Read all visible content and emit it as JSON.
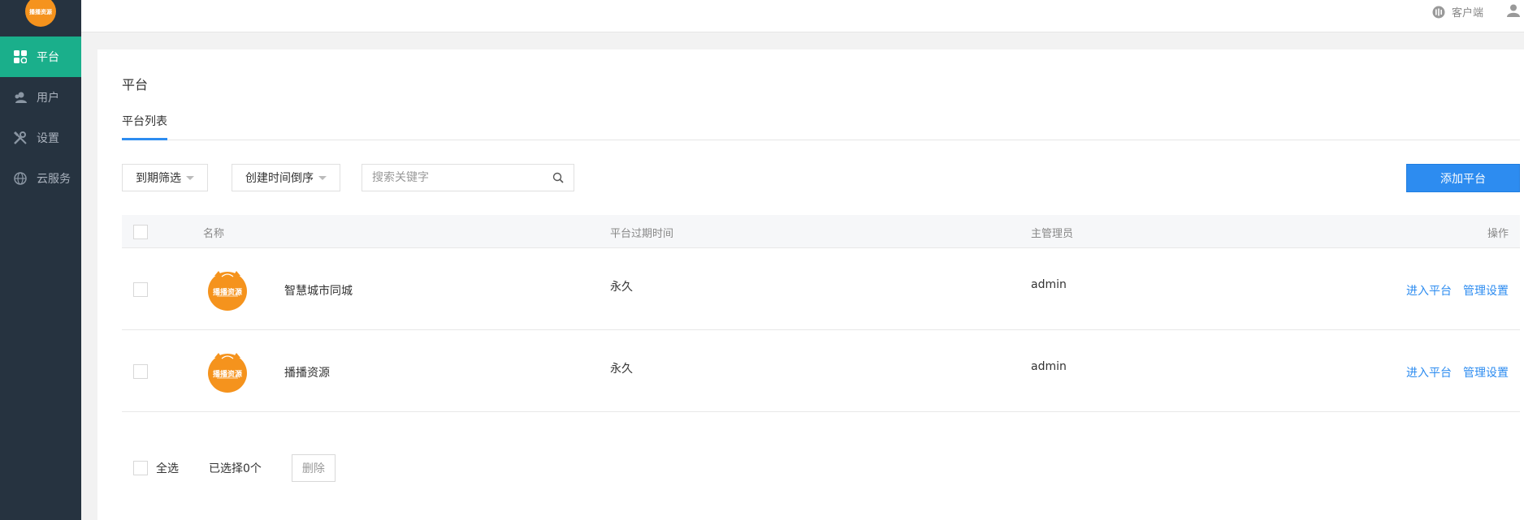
{
  "sidebar": {
    "logo_text": "播播资源",
    "items": [
      {
        "label": "平台",
        "icon": "grid-icon",
        "active": true
      },
      {
        "label": "用户",
        "icon": "users-icon",
        "active": false
      },
      {
        "label": "设置",
        "icon": "wrench-icon",
        "active": false
      },
      {
        "label": "云服务",
        "icon": "globe-icon",
        "active": false
      }
    ]
  },
  "topbar": {
    "client_label": "客户端"
  },
  "page": {
    "title": "平台",
    "tab_active": "平台列表"
  },
  "toolbar": {
    "filter_expire": "到期筛选",
    "sort_created": "创建时间倒序",
    "search_placeholder": "搜索关键字",
    "add_button": "添加平台"
  },
  "table": {
    "headers": {
      "name": "名称",
      "expire": "平台过期时间",
      "admin": "主管理员",
      "actions": "操作"
    },
    "rows": [
      {
        "name": "智慧城市同城",
        "expire": "永久",
        "admin": "admin",
        "enter": "进入平台",
        "manage": "管理设置",
        "logo_text": "播播资源"
      },
      {
        "name": "播播资源",
        "expire": "永久",
        "admin": "admin",
        "enter": "进入平台",
        "manage": "管理设置",
        "logo_text": "播播资源"
      }
    ]
  },
  "footer": {
    "select_all": "全选",
    "selected_count": "已选择0个",
    "delete_button": "删除"
  },
  "colors": {
    "sidebar_bg": "#263340",
    "sidebar_active": "#1aaf8b",
    "primary": "#2d8cf0",
    "logo_orange": "#f5931d"
  }
}
